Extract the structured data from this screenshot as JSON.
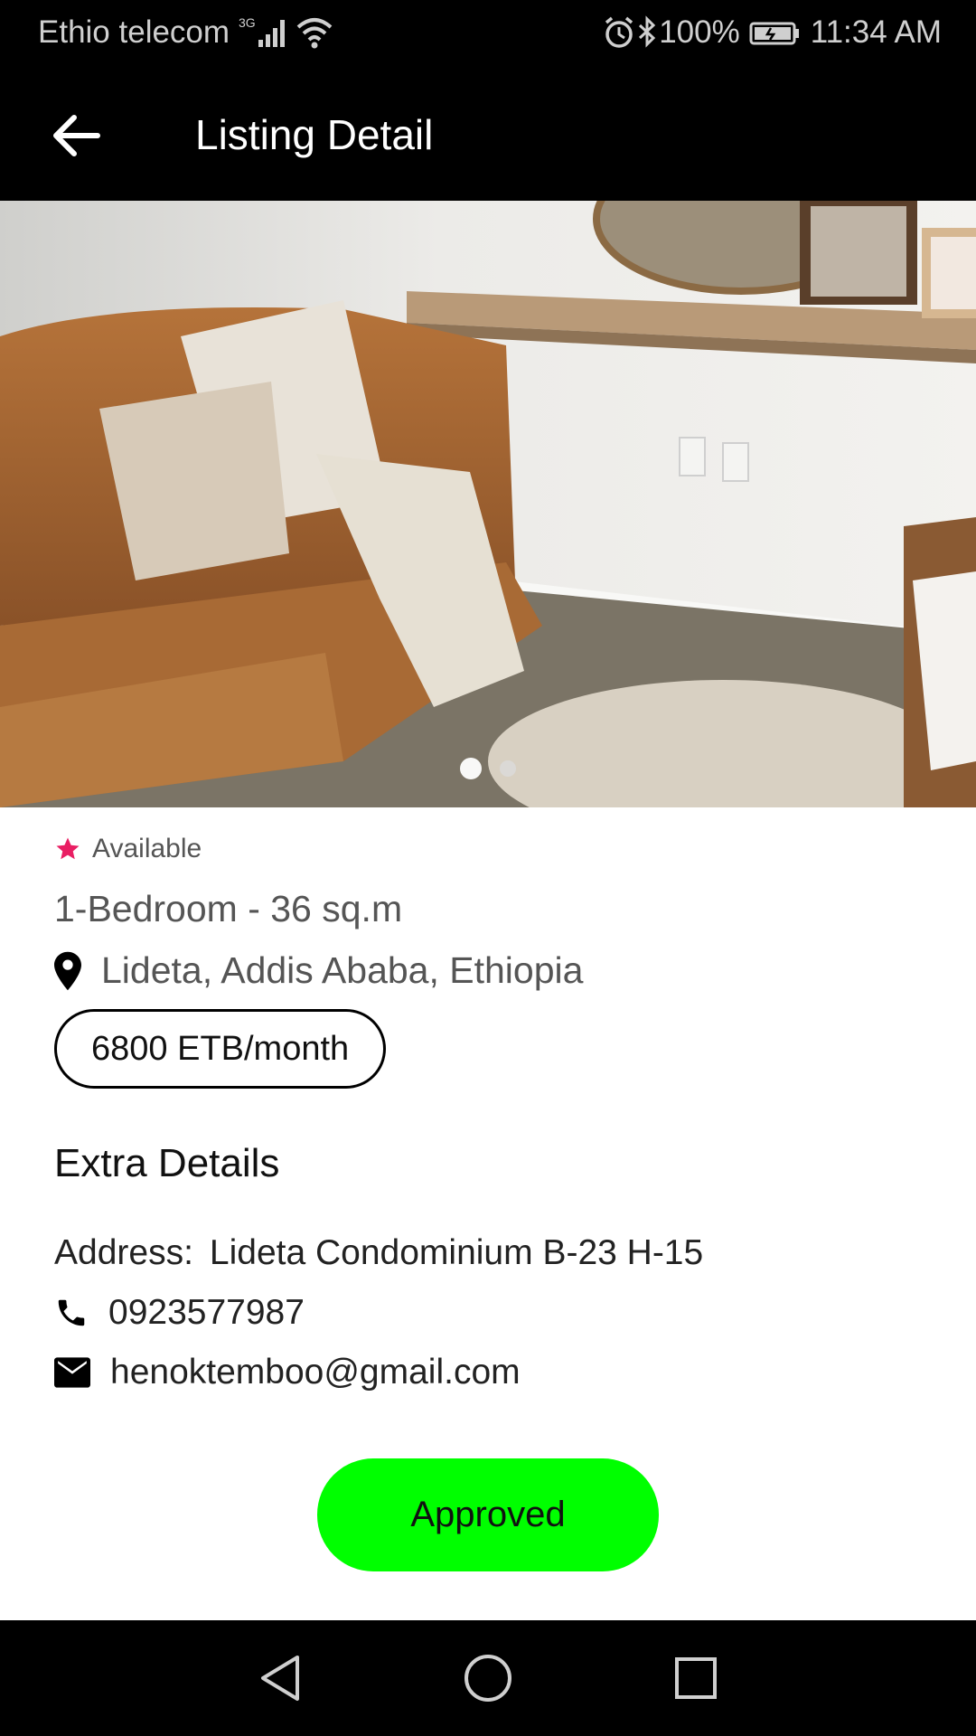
{
  "status_bar": {
    "carrier": "Ethio telecom",
    "network_type": "3G",
    "battery": "100%",
    "time": "11:34 AM",
    "icons": [
      "signal-icon",
      "wifi-icon",
      "alarm-icon",
      "bluetooth-icon",
      "battery-icon"
    ]
  },
  "app_bar": {
    "title": "Listing Detail",
    "back_icon": "arrow-left-icon"
  },
  "gallery": {
    "image_count": 2,
    "active_index": 0
  },
  "listing": {
    "availability": "Available",
    "title": "1-Bedroom - 36 sq.m",
    "location": "Lideta, Addis Ababa, Ethiopia",
    "price": "6800 ETB/month"
  },
  "extra_details": {
    "heading": "Extra Details",
    "address_label": "Address:",
    "address_value": "Lideta Condominium B-23 H-15",
    "phone": "0923577987",
    "email": "henoktemboo@gmail.com"
  },
  "status_button": {
    "label": "Approved",
    "color": "#00ff00"
  },
  "colors": {
    "star": "#e91e63",
    "bars": "#000000"
  },
  "nav_bar": {
    "icons": [
      "back-triangle-icon",
      "home-circle-icon",
      "recents-square-icon"
    ]
  }
}
